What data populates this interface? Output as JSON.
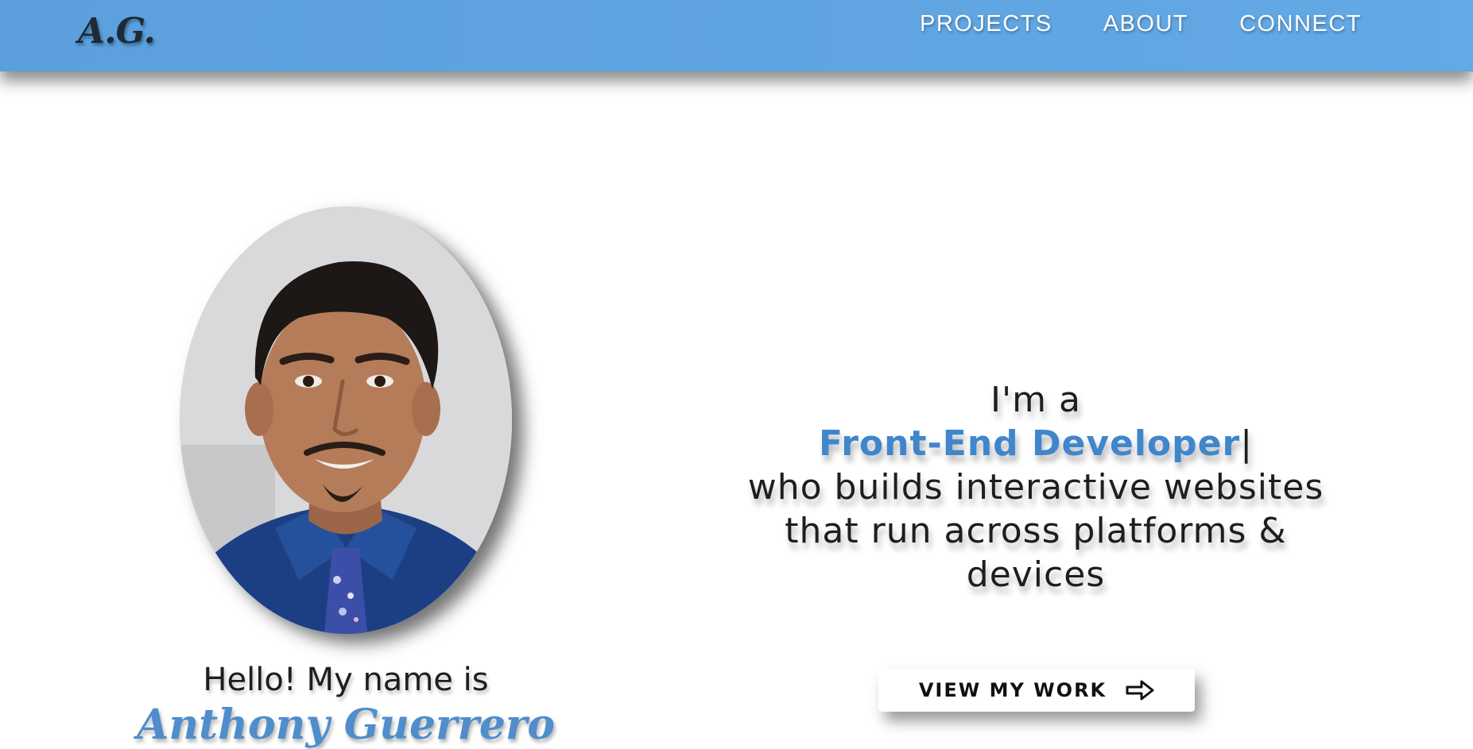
{
  "header": {
    "logo": "A.G.",
    "nav": [
      {
        "label": "PROJECTS"
      },
      {
        "label": "ABOUT"
      },
      {
        "label": "CONNECT"
      }
    ]
  },
  "hero": {
    "portrait_icon": "person-portrait",
    "greeting": "Hello! My name is",
    "name": "Anthony Guerrero",
    "tagline": {
      "prefix": "I'm a",
      "role": "Front-End Developer",
      "cursor": "|",
      "line3": "who builds interactive websites",
      "line4": "that run across platforms &",
      "line5": "devices"
    },
    "cta": {
      "label": "VIEW MY WORK",
      "icon": "arrow-right-icon"
    }
  },
  "colors": {
    "navbar": "#5b9fdd",
    "accent": "#3f86cc",
    "name": "#4f8dcc",
    "text": "#1e1e1e"
  }
}
